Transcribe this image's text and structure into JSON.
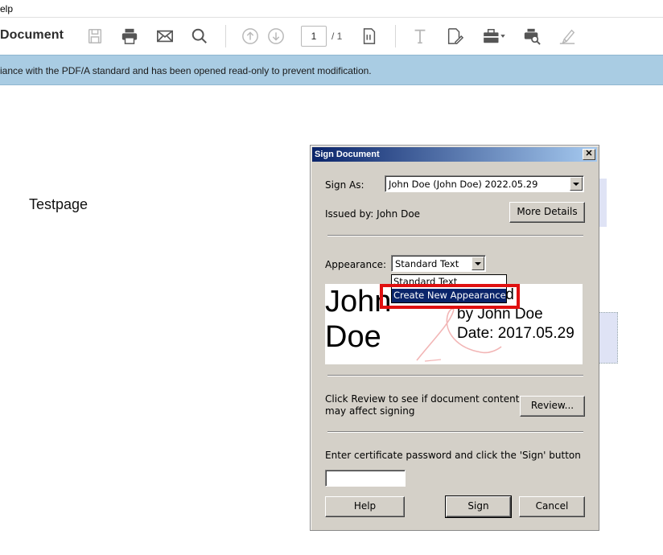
{
  "menubar": {
    "text": "elp"
  },
  "toolbar": {
    "title": "Document",
    "page_current": "1",
    "page_total": "/ 1"
  },
  "infobar": {
    "text": "iance with the PDF/A standard and has been opened read-only to prevent modification."
  },
  "document": {
    "page_text": "Testpage"
  },
  "dialog": {
    "title": "Sign Document",
    "close_label": "✕",
    "sign_as_label": "Sign As:",
    "sign_as_value": "John Doe (John Doe) 2022.05.29",
    "issued_by": "Issued by: John Doe",
    "more_details": "More Details",
    "appearance_label": "Appearance:",
    "appearance_value": "Standard Text",
    "appearance_options": [
      "Standard Text",
      "Create New Appearance ..."
    ],
    "preview": {
      "name_line1": "John",
      "name_line2": "Doe",
      "detail_line1": "y signed",
      "detail_line2": "by John Doe",
      "detail_line3": "Date: 2017.05.29"
    },
    "review_text_line1": "Click Review to see if document content",
    "review_text_line2": "may affect signing",
    "review_button": "Review...",
    "password_label": "Enter certificate password and click the 'Sign' button",
    "password_value": "",
    "help_button": "Help",
    "sign_button": "Sign",
    "cancel_button": "Cancel"
  },
  "colors": {
    "infobar_bg": "#a9cce3",
    "titlebar_start": "#0a246a",
    "highlight": "#e01010",
    "dialog_bg": "#d4d0c8"
  }
}
